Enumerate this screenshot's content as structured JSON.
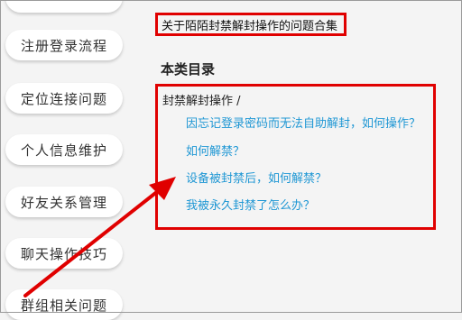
{
  "sidebar": {
    "items": [
      {
        "label": "注册登录流程"
      },
      {
        "label": "定位连接问题"
      },
      {
        "label": "个人信息维护"
      },
      {
        "label": "好友关系管理"
      },
      {
        "label": "聊天操作技巧"
      },
      {
        "label": "群组相关问题"
      }
    ]
  },
  "main": {
    "page_title": "关于陌陌封禁解封操作的问题合集",
    "section_title": "本类目录",
    "category": {
      "label": "封禁解封操作 /",
      "links": [
        "因忘记登录密码而无法自助解封，如何操作？",
        "如何解禁？",
        "设备被封禁后，如何解禁？",
        "我被永久封禁了怎么办？"
      ]
    }
  },
  "colors": {
    "highlight_red": "#e00000",
    "link_blue": "#1f97d4"
  }
}
